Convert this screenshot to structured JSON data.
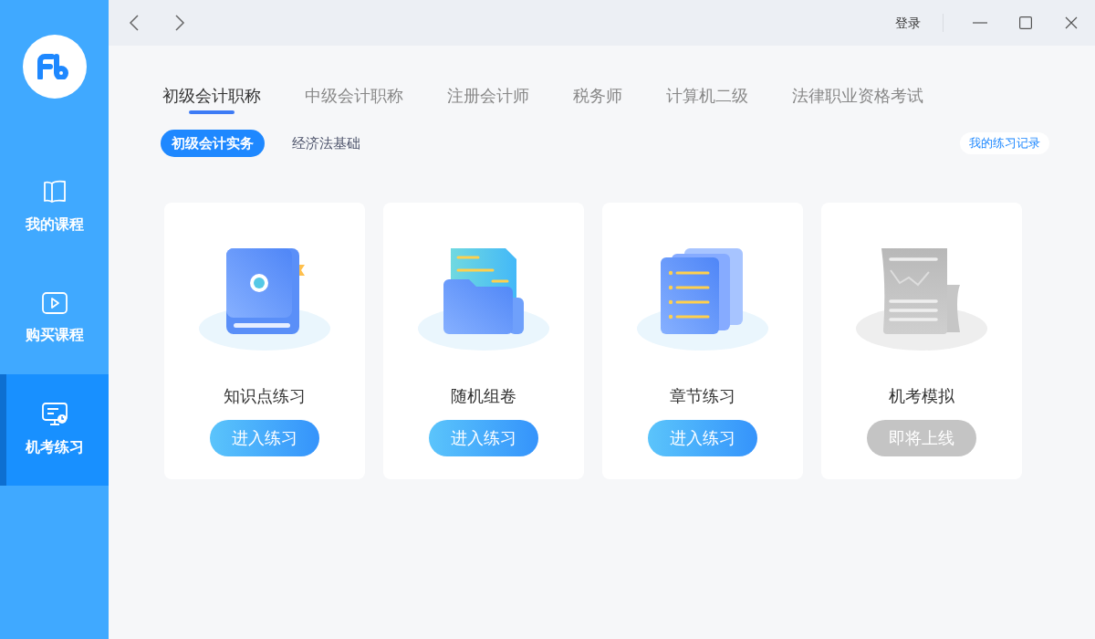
{
  "sidebar": {
    "items": [
      {
        "label": "我的课程",
        "kind": "book",
        "selected": false
      },
      {
        "label": "购买课程",
        "kind": "video",
        "selected": false
      },
      {
        "label": "机考练习",
        "kind": "monitor",
        "selected": true
      }
    ]
  },
  "top_bar": {
    "login": "登录"
  },
  "tabs": [
    {
      "label": "初级会计职称",
      "selected": true
    },
    {
      "label": "中级会计职称",
      "selected": false
    },
    {
      "label": "注册会计师",
      "selected": false
    },
    {
      "label": "税务师",
      "selected": false
    },
    {
      "label": "计算机二级",
      "selected": false
    },
    {
      "label": "法律职业资格考试",
      "selected": false
    }
  ],
  "subtabs": [
    {
      "label": "初级会计实务",
      "selected": true
    },
    {
      "label": "经济法基础",
      "selected": false
    }
  ],
  "record_link": "我的练习记录",
  "cards": [
    {
      "title": "知识点练习",
      "kind": "book",
      "button": "进入练习",
      "disabled": false
    },
    {
      "title": "随机组卷",
      "kind": "folder",
      "button": "进入练习",
      "disabled": false
    },
    {
      "title": "章节练习",
      "kind": "pages",
      "button": "进入练习",
      "disabled": false
    },
    {
      "title": "机考模拟",
      "kind": "report",
      "button": "即将上线",
      "disabled": true
    }
  ]
}
